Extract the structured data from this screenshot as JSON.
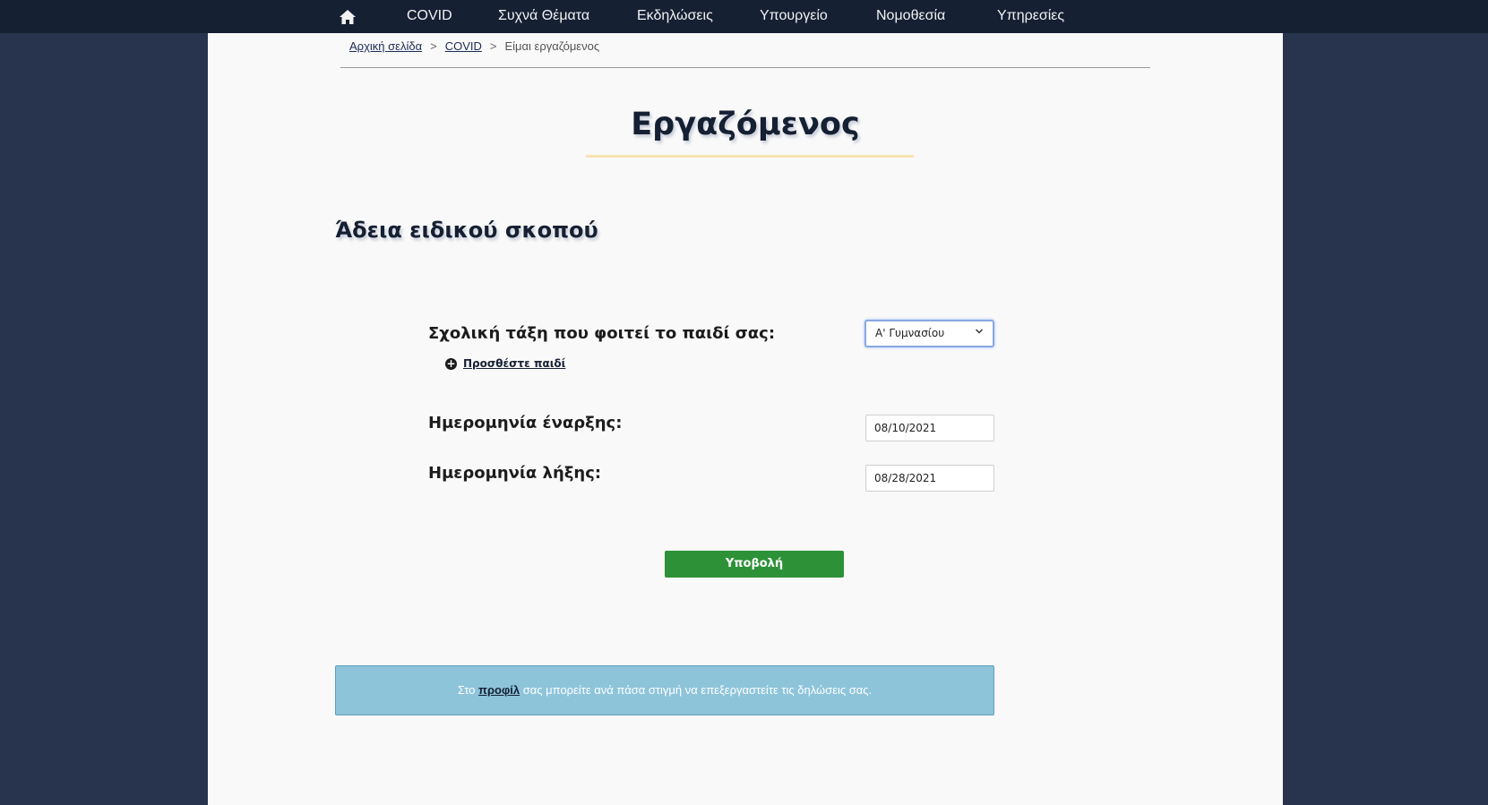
{
  "nav": {
    "items": [
      "COVID",
      "Συχνά Θέματα",
      "Εκδηλώσεις",
      "Υπουργείο",
      "Νομοθεσία",
      "Υπηρεσίες"
    ],
    "home_icon": "home-icon"
  },
  "breadcrumb": {
    "home": "Αρχική σελίδα",
    "covid": "COVID",
    "current": "Είμαι εργαζόμενος",
    "sep": ">"
  },
  "page": {
    "title": "Εργαζόμενος",
    "section_title": "Άδεια ειδικού σκοπού"
  },
  "form": {
    "class_label": "Σχολική τάξη που φοιτεί το παιδί σας:",
    "class_value": "Α' Γυμνασίου",
    "add_child_label": "Προσθέστε παιδί",
    "start_label": "Ημερομηνία έναρξης:",
    "start_value": "08/10/2021",
    "end_label": "Ημερομηνία λήξης:",
    "end_value": "08/28/2021",
    "submit_label": "Υποβολή"
  },
  "info": {
    "prefix": "Στο",
    "link": "προφίλ",
    "suffix": "σας μπορείτε ανά πάσα στιγμή να επεξεργαστείτε τις δηλώσεις σας."
  },
  "colors": {
    "nav_bg": "#152033",
    "page_bg": "#28334d",
    "submit_green": "#2d9237",
    "info_blue": "#8dc4da",
    "title_underline": "#f7e2b3"
  }
}
